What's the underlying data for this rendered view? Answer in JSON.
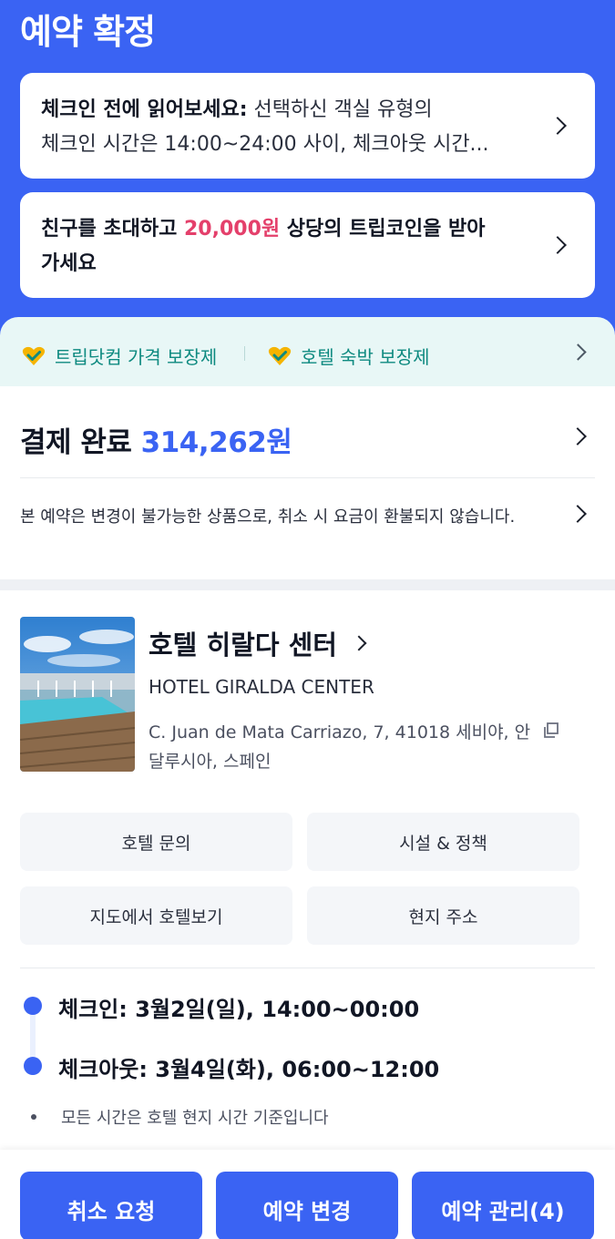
{
  "header": {
    "title": "예약 확정",
    "checkin_card": {
      "bold": "체크인 전에 읽어보세요:",
      "line1_rest": " 선택하신 객실 유형의",
      "line2": "체크인 시간은 14:00~24:00 사이, 체크아웃 시간..."
    },
    "invite_card": {
      "before": "친구를 초대하고 ",
      "highlight": "20,000원",
      "after": " 상당의 트립코인을 받아",
      "line2": "가세요"
    }
  },
  "guarantee": {
    "item1": "트립닷컴 가격 보장제",
    "item2": "호텔 숙박 보장제"
  },
  "payment": {
    "label": "결제 완료 ",
    "amount": "314,262원",
    "note": "본 예약은 변경이 불가능한 상품으로, 취소 시 요금이 환불되지 않습니다."
  },
  "hotel": {
    "name": "호텔 히랄다 센터",
    "name_en": "HOTEL GIRALDA CENTER",
    "address": "C. Juan de Mata Carriazo, 7, 41018 세비야, 안달루시아, 스페인"
  },
  "actions": {
    "inquiry": "호텔 문의",
    "facilities": "시설 & 정책",
    "map": "지도에서 호텔보기",
    "local_address": "현지 주소"
  },
  "stay": {
    "checkin": "체크인: 3월2일(일), 14:00~00:00",
    "checkout": "체크아웃: 3월4일(화), 06:00~12:00",
    "note": "모든 시간은 호텔 현지 시간 기준입니다"
  },
  "bottom": {
    "cancel": "취소 요청",
    "change": "예약 변경",
    "manage": "예약 관리(4)"
  },
  "colors": {
    "brand_blue": "#3a63f3",
    "highlight_pink": "#e4406b",
    "guarantee_teal": "#0e8a80"
  }
}
